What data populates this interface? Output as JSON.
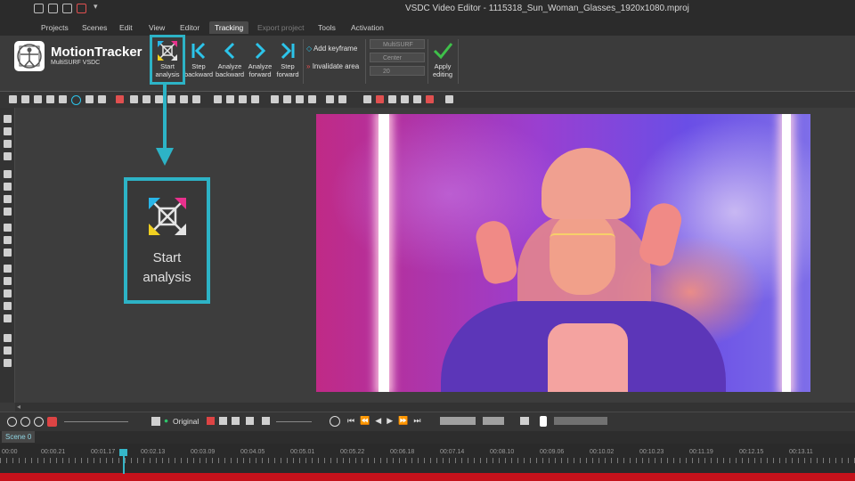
{
  "window": {
    "title": "VSDC Video Editor - 1115318_Sun_Woman_Glasses_1920x1080.mproj"
  },
  "menu": {
    "items": [
      {
        "label": "Projects"
      },
      {
        "label": "Scenes"
      },
      {
        "label": "Edit"
      },
      {
        "label": "View"
      },
      {
        "label": "Editor"
      },
      {
        "label": "Tracking"
      },
      {
        "label": "Export project"
      },
      {
        "label": "Tools"
      },
      {
        "label": "Activation"
      }
    ],
    "active": "Tracking"
  },
  "ribbon": {
    "brand_title": "MotionTracker",
    "brand_subtitle": "MultiSURF VSDC",
    "buttons": {
      "start_analysis": "Start analysis",
      "step_backward": "Step backward",
      "analyze_backward": "Analyze backward",
      "analyze_forward": "Analyze forward",
      "step_forward": "Step forward",
      "apply_editing": "Apply editing"
    },
    "keyframe": {
      "add_label": "Add keyframe",
      "invalidate_label": "Invalidate area"
    },
    "fields": {
      "algorithm": "MultiSURF",
      "position": "Center",
      "value": "20"
    }
  },
  "annotation": {
    "label": "Start analysis",
    "color": "#2db3c6"
  },
  "timeline_controls": {
    "view_mode": "Original"
  },
  "timeline": {
    "scene_tab": "Scene 0",
    "ticks": [
      "00:00",
      "00:00.21",
      "00:01.17",
      "00:02.13",
      "00:03.09",
      "00:04.05",
      "00:05.01",
      "00:05.22",
      "00:06.18",
      "00:07.14",
      "00:08.10",
      "00:09.06",
      "00:10.02",
      "00:10.23",
      "00:11.19",
      "00:12.15",
      "00:13.11"
    ],
    "accent_color": "#c5121b"
  }
}
